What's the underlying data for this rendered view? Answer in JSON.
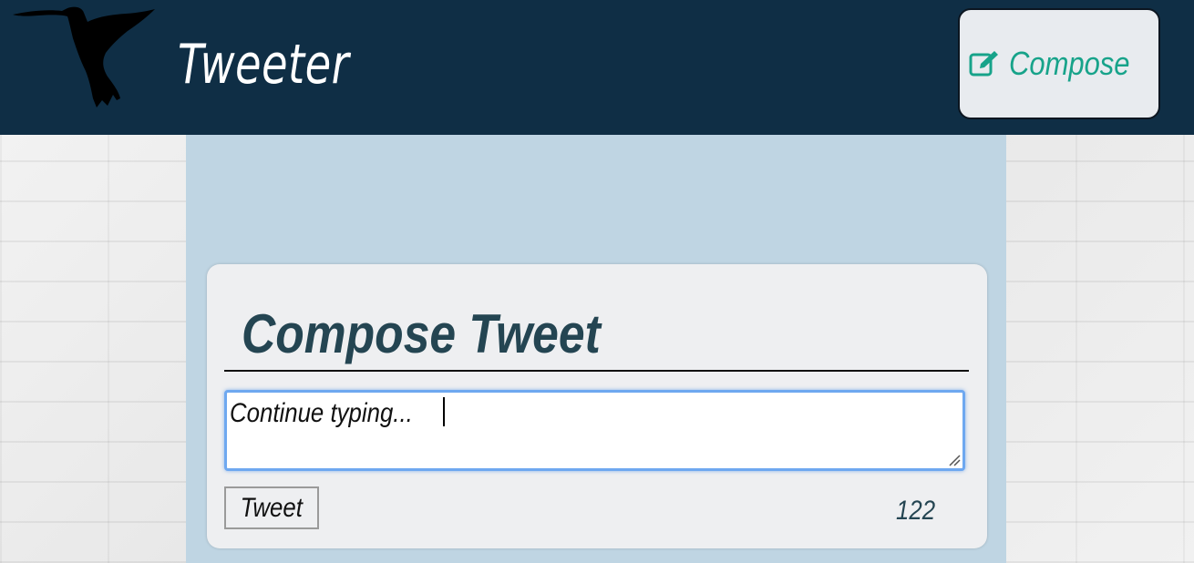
{
  "header": {
    "title": "Tweeter",
    "logo_icon": "hummingbird-icon",
    "compose_button": {
      "label": "Compose",
      "icon": "edit-icon"
    }
  },
  "compose_card": {
    "heading": "Compose Tweet",
    "textarea_value": "Continue typing...",
    "submit_label": "Tweet",
    "char_counter": "122"
  },
  "colors": {
    "header_bg": "#0f2e45",
    "accent": "#17a38a",
    "column_bg": "#bfd5e3",
    "card_bg": "#eeeff1",
    "heading_text": "#244552"
  }
}
